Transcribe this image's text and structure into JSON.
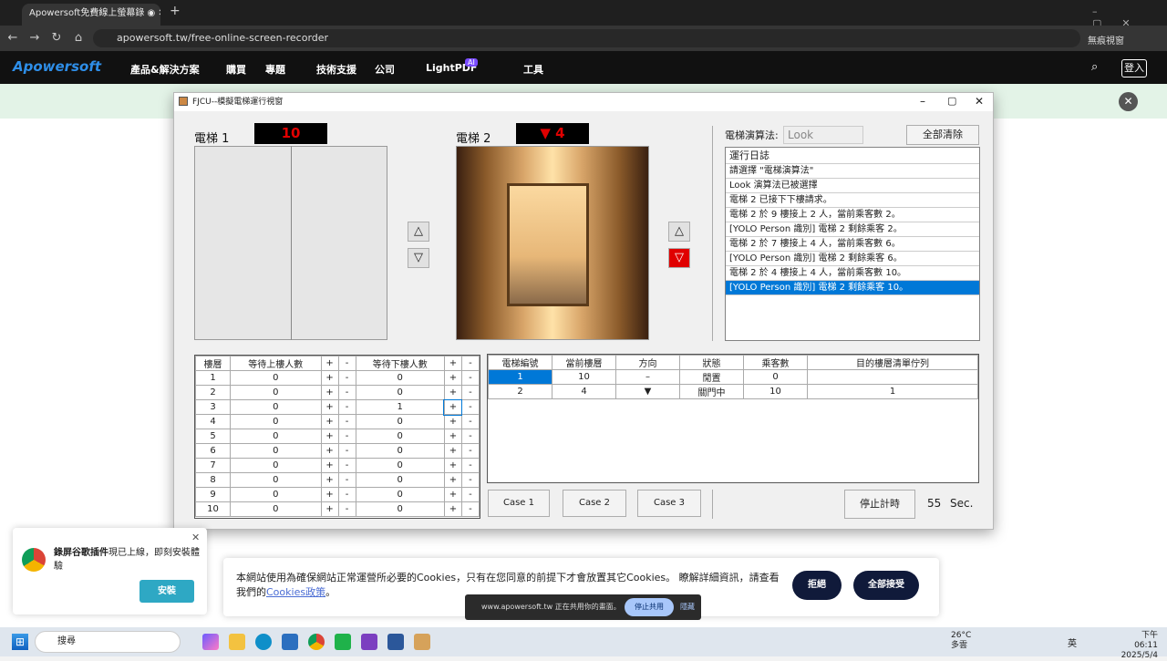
{
  "browser": {
    "tab_title": "Apowersoft免費線上螢幕錄",
    "url": "apowersoft.tw/free-online-screen-recorder",
    "incognito_label": "無痕視窗"
  },
  "site": {
    "logo": "Apowersoft",
    "nav": [
      "產品&解決方案",
      "購買",
      "專題",
      "技術支援",
      "公司",
      "LightPDF",
      "工具"
    ],
    "ai_badge": "AI",
    "login": "登入"
  },
  "app": {
    "title": "FJCU--模擬電梯運行視窗",
    "elevator1": {
      "label": "電梯 1",
      "display": "10"
    },
    "elevator2": {
      "label": "電梯 2",
      "display": "▼ 4"
    },
    "up_glyph": "△",
    "down_glyph": "▽",
    "algo_label": "電梯演算法:",
    "algo_value": "Look",
    "clear_all": "全部清除",
    "log_header": "運行日誌",
    "log": [
      "請選擇 \"電梯演算法\"",
      "Look 演算法已被選擇",
      "電梯 2 已接下下樓請求。",
      "電梯 2 於 9 樓接上 2 人，當前乘客數 2。",
      "[YOLO Person 識別] 電梯 2 剩餘乘客 2。",
      "電梯 2 於 7 樓接上 4 人，當前乘客數 6。",
      "[YOLO Person 識別] 電梯 2 剩餘乘客 6。",
      "電梯 2 於 4 樓接上 4 人，當前乘客數 10。",
      "[YOLO Person 識別] 電梯 2 剩餘乘客 10。"
    ],
    "floor_headers": [
      "樓層",
      "等待上樓人數",
      "+",
      "-",
      "等待下樓人數",
      "+",
      "-"
    ],
    "floors": [
      [
        "1",
        "0",
        "0"
      ],
      [
        "2",
        "0",
        "0"
      ],
      [
        "3",
        "0",
        "1"
      ],
      [
        "4",
        "0",
        "0"
      ],
      [
        "5",
        "0",
        "0"
      ],
      [
        "6",
        "0",
        "0"
      ],
      [
        "7",
        "0",
        "0"
      ],
      [
        "8",
        "0",
        "0"
      ],
      [
        "9",
        "0",
        "0"
      ],
      [
        "10",
        "0",
        "0"
      ]
    ],
    "status_headers": [
      "電梯編號",
      "當前樓層",
      "方向",
      "狀態",
      "乘客數",
      "目的樓層清單佇列"
    ],
    "status": [
      [
        "1",
        "10",
        "–",
        "閒置",
        "0",
        ""
      ],
      [
        "2",
        "4",
        "▼",
        "關門中",
        "10",
        "1"
      ]
    ],
    "case_buttons": [
      "Case 1",
      "Case 2",
      "Case 3"
    ],
    "stop_timer": "停止計時",
    "seconds": "55",
    "sec_label": "Sec."
  },
  "cookie": {
    "text": "本網站使用為確保網站正常運營所必要的Cookies，只有在您同意的前提下才會放置其它Cookies。 瞭解詳細資訊，請查看我們的",
    "link": "Cookies政策",
    "reject": "拒絕",
    "accept": "全部接受"
  },
  "share_bar": {
    "text": "www.apowersoft.tw 正在共用你的畫面。",
    "stop": "停止共用",
    "hide": "隱藏"
  },
  "chrome_ext": {
    "title": "錄屏谷歌插件",
    "text": "現已上線，即刻安裝體驗",
    "install": "安裝"
  },
  "taskbar": {
    "search": "搜尋",
    "weather_temp": "26°C",
    "weather_desc": "多雲",
    "lang": "英",
    "time": "下午 06:11",
    "date": "2025/5/4"
  },
  "colors": {
    "accent": "#0078d7",
    "display_red": "#e00000",
    "navy": "#101a3a"
  }
}
